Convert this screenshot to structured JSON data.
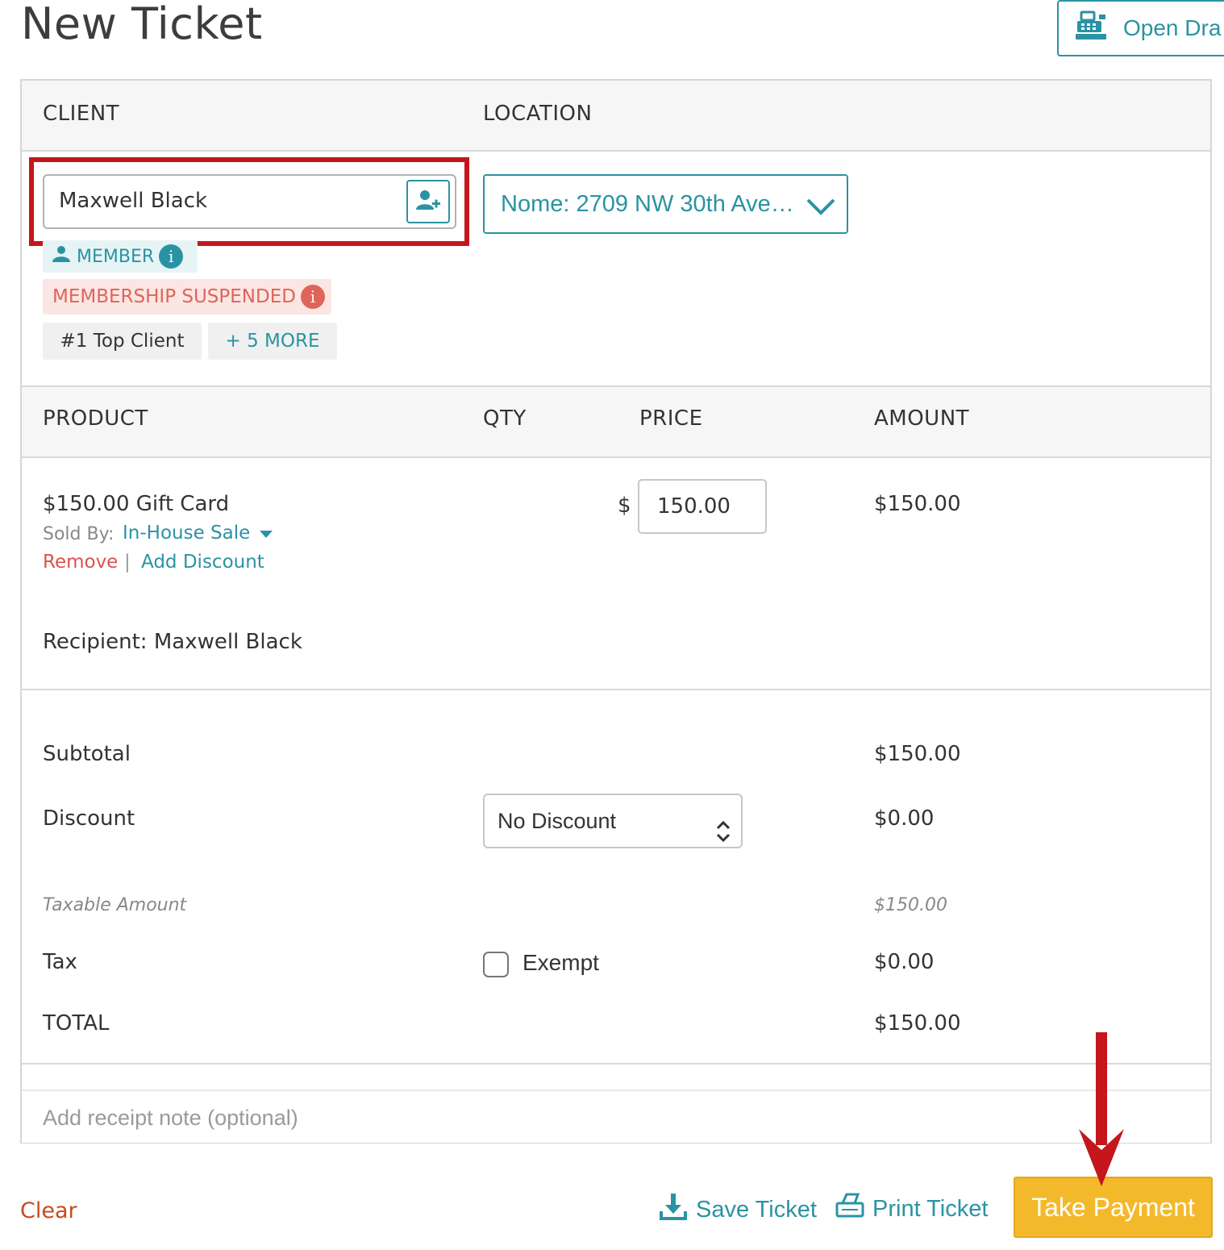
{
  "page": {
    "title": "New Ticket"
  },
  "header": {
    "open_drawer_label": "Open Dra"
  },
  "client_section": {
    "client_header": "CLIENT",
    "location_header": "LOCATION",
    "client_name": "Maxwell Black",
    "location_value": "Nome: 2709 NW 30th Ave…",
    "badges": {
      "member": "MEMBER",
      "suspended": "MEMBERSHIP SUSPENDED",
      "top_client": "#1 Top Client",
      "more": "+ 5 MORE",
      "info_glyph": "i"
    }
  },
  "products": {
    "headers": {
      "product": "PRODUCT",
      "qty": "QTY",
      "price": "PRICE",
      "amount": "AMOUNT"
    },
    "items": [
      {
        "name": "$150.00 Gift Card",
        "sold_by_label": "Sold By:",
        "sold_by_value": "In-House Sale",
        "remove_label": "Remove",
        "separator": "|",
        "add_discount_label": "Add Discount",
        "currency_symbol": "$",
        "price": "150.00",
        "amount": "$150.00",
        "recipient": "Recipient: Maxwell Black"
      }
    ]
  },
  "totals": {
    "subtotal_label": "Subtotal",
    "subtotal_value": "$150.00",
    "discount_label": "Discount",
    "discount_select": "No Discount",
    "discount_value": "$0.00",
    "taxable_label": "Taxable Amount",
    "taxable_value": "$150.00",
    "tax_label": "Tax",
    "exempt_label": "Exempt",
    "exempt_checked": false,
    "tax_value": "$0.00",
    "total_label": "TOTAL",
    "total_value": "$150.00"
  },
  "receipt_note": {
    "placeholder": "Add receipt note (optional)"
  },
  "footer": {
    "clear_label": "Clear",
    "save_label": "Save Ticket",
    "print_label": "Print Ticket",
    "take_payment_label": "Take Payment"
  },
  "colors": {
    "accent": "#2a93a3",
    "danger": "#d9534f",
    "highlight_box": "#c4161c",
    "pay_button": "#f4b92b",
    "annotation_arrow": "#c4161c"
  },
  "icons": {
    "open_drawer": "cash-register-icon",
    "add_client": "add-user-icon",
    "member": "person-icon",
    "location_dropdown": "chevron-down-icon",
    "sold_by_dropdown": "caret-down-icon",
    "discount_select": "up-down-icon",
    "save": "download-icon",
    "print": "printer-icon"
  }
}
